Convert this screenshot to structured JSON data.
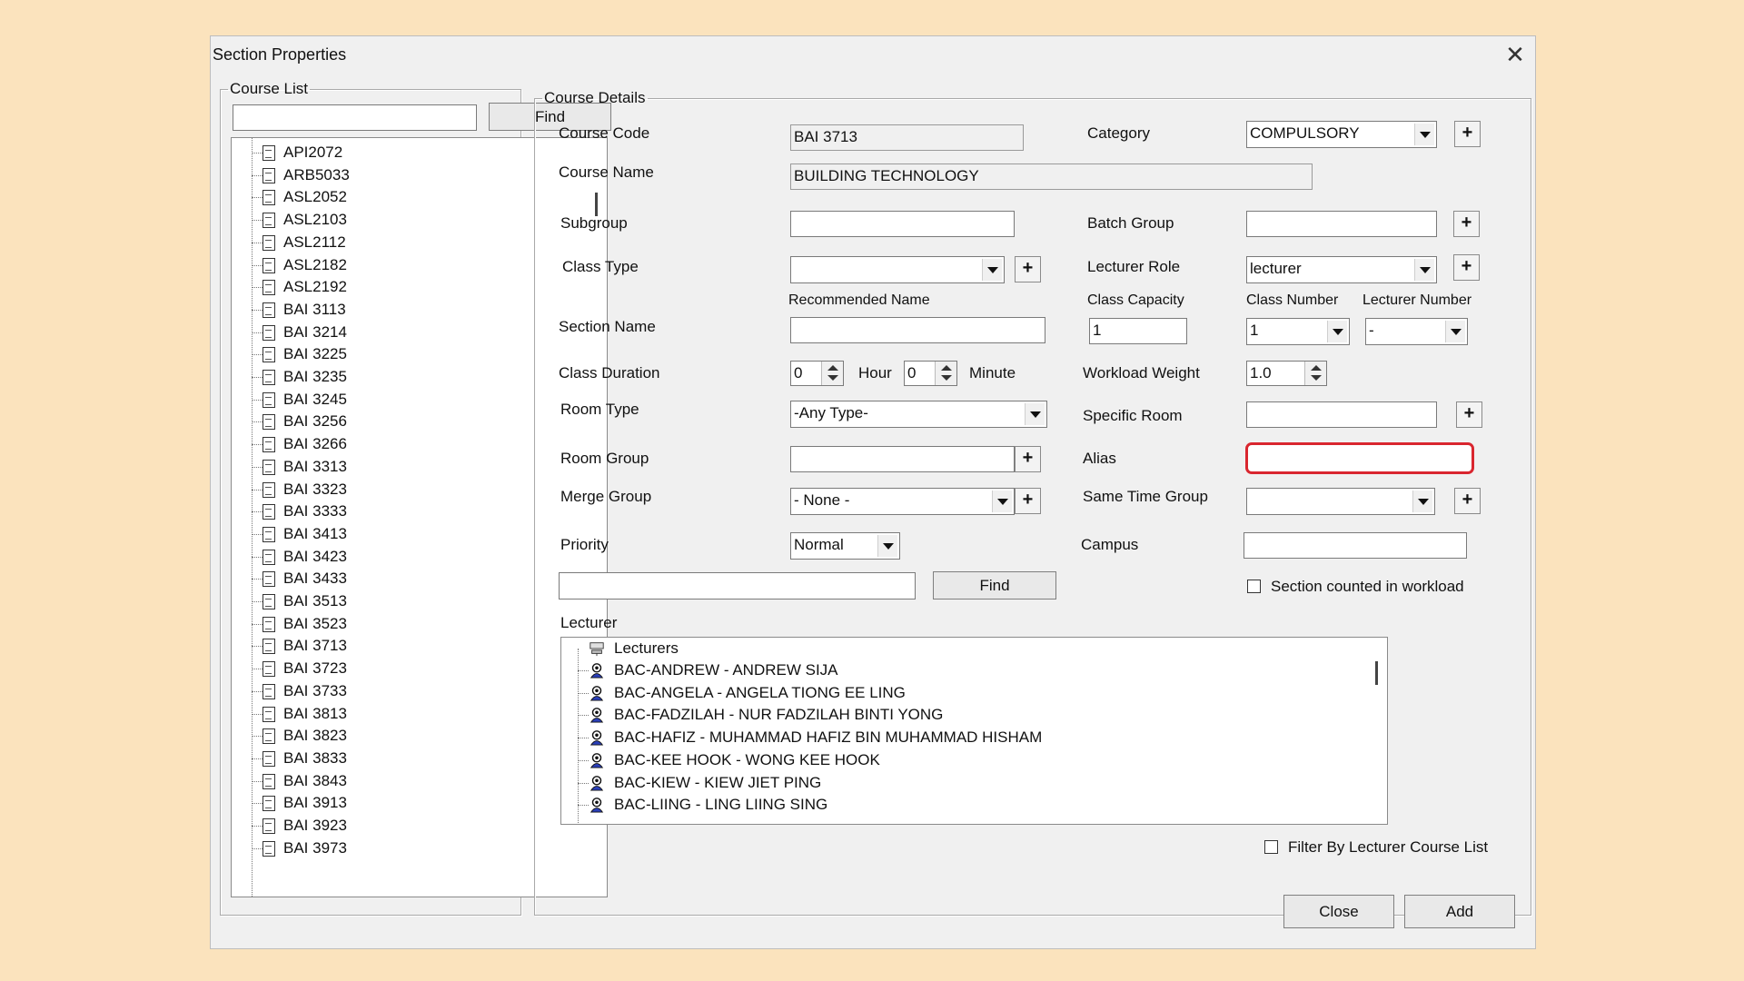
{
  "window": {
    "title": "Section Properties",
    "close_glyph": "✕"
  },
  "course_list": {
    "legend": "Course List",
    "search_value": "",
    "find_label": "Find",
    "items": [
      "API2072",
      "ARB5033",
      "ASL2052",
      "ASL2103",
      "ASL2112",
      "ASL2182",
      "ASL2192",
      "BAI 3113",
      "BAI 3214",
      "BAI 3225",
      "BAI 3235",
      "BAI 3245",
      "BAI 3256",
      "BAI 3266",
      "BAI 3313",
      "BAI 3323",
      "BAI 3333",
      "BAI 3413",
      "BAI 3423",
      "BAI 3433",
      "BAI 3513",
      "BAI 3523",
      "BAI 3713",
      "BAI 3723",
      "BAI 3733",
      "BAI 3813",
      "BAI 3823",
      "BAI 3833",
      "BAI 3843",
      "BAI 3913",
      "BAI 3923",
      "BAI 3973"
    ]
  },
  "details": {
    "legend": "Course Details",
    "course_code": {
      "label": "Course Code",
      "value": "BAI 3713"
    },
    "course_name": {
      "label": "Course Name",
      "value": "BUILDING TECHNOLOGY"
    },
    "category": {
      "label": "Category",
      "value": "COMPULSORY"
    },
    "subgroup": {
      "label": "Subgroup",
      "value": ""
    },
    "batch_group": {
      "label": "Batch Group",
      "value": ""
    },
    "class_type": {
      "label": "Class Type",
      "value": ""
    },
    "lecturer_role": {
      "label": "Lecturer Role",
      "value": "lecturer"
    },
    "recommended_name_label": "Recommended Name",
    "section_name": {
      "label": "Section Name",
      "value": ""
    },
    "class_capacity": {
      "label": "Class Capacity",
      "value": "1"
    },
    "class_number": {
      "label": "Class Number",
      "value": "1"
    },
    "lecturer_number": {
      "label": "Lecturer Number",
      "value": "-"
    },
    "class_duration": {
      "label": "Class Duration",
      "hour_value": "0",
      "hour_label": "Hour",
      "minute_value": "0",
      "minute_label": "Minute"
    },
    "workload_weight": {
      "label": "Workload Weight",
      "value": "1.0"
    },
    "room_type": {
      "label": "Room Type",
      "value": "-Any Type-"
    },
    "specific_room": {
      "label": "Specific Room",
      "value": ""
    },
    "room_group": {
      "label": "Room Group",
      "value": ""
    },
    "alias": {
      "label": "Alias",
      "value": ""
    },
    "merge_group": {
      "label": "Merge Group",
      "value": "- None -"
    },
    "same_time_group": {
      "label": "Same Time Group",
      "value": ""
    },
    "priority": {
      "label": "Priority",
      "value": "Normal"
    },
    "campus": {
      "label": "Campus",
      "value": ""
    },
    "lecturer_search": {
      "value": "",
      "find_label": "Find"
    },
    "section_counted_label": "Section counted in workload",
    "lecturer_label": "Lecturer",
    "lecturers_root": "Lecturers",
    "lecturers": [
      "BAC-ANDREW - ANDREW SIJA",
      "BAC-ANGELA - ANGELA TIONG EE LING",
      "BAC-FADZILAH - NUR FADZILAH BINTI YONG",
      "BAC-HAFIZ - MUHAMMAD HAFIZ BIN MUHAMMAD HISHAM",
      "BAC-KEE HOOK - WONG KEE HOOK",
      "BAC-KIEW - KIEW JIET PING",
      "BAC-LIING - LING LIING SING"
    ],
    "filter_label": "Filter By Lecturer Course List",
    "plus_glyph": "+"
  },
  "footer": {
    "close_label": "Close",
    "add_label": "Add"
  },
  "colors": {
    "highlight": "#d9262f",
    "background": "#fbe3bd",
    "dialog": "#f0f0f0"
  }
}
